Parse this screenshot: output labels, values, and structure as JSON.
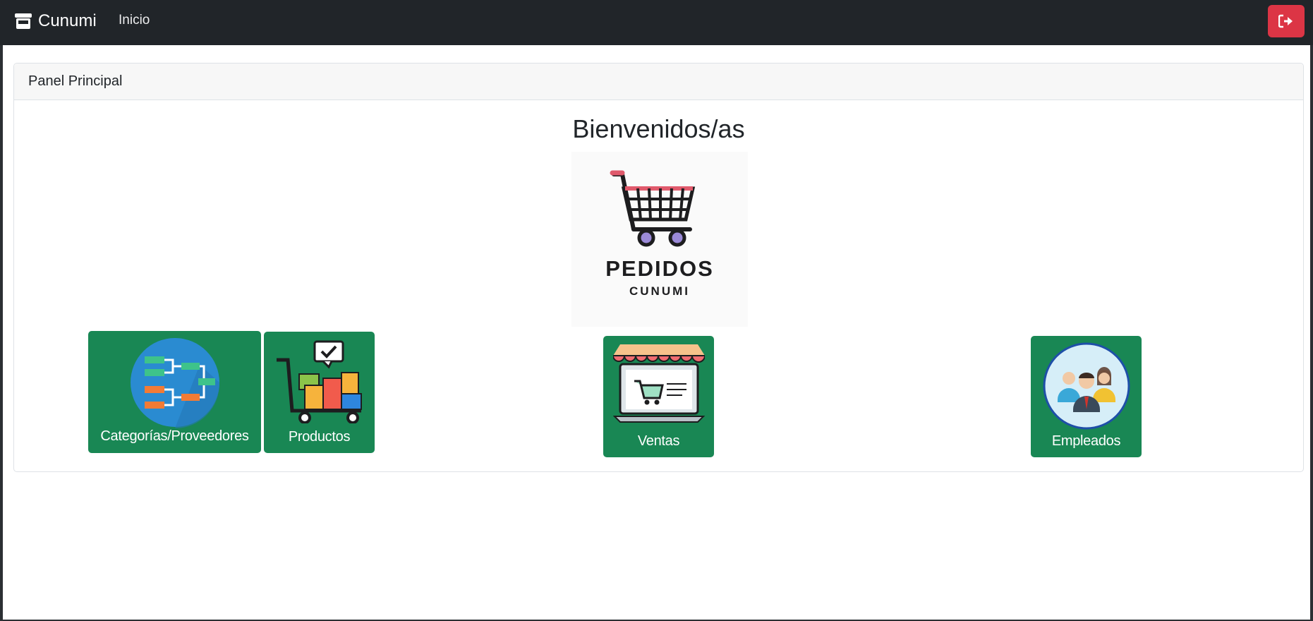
{
  "navbar": {
    "brand": "Cunumi",
    "brand_icon": "store-icon",
    "links": [
      {
        "label": "Inicio"
      }
    ],
    "logout_icon": "sign-out-icon",
    "colors": {
      "background": "#212529",
      "logout": "#dc3545"
    }
  },
  "panel": {
    "header": "Panel Principal",
    "welcome": "Bienvenidos/as",
    "logo": {
      "title": "PEDIDOS",
      "subtitle": "CUNUMI",
      "icon": "shopping-cart-icon"
    }
  },
  "tiles": [
    {
      "label": "Categorías/Proveedores",
      "icon": "hierarchy-icon"
    },
    {
      "label": "Productos",
      "icon": "product-cart-icon"
    },
    {
      "label": "Ventas",
      "icon": "online-store-icon"
    },
    {
      "label": "Empleados",
      "icon": "employees-icon"
    }
  ],
  "colors": {
    "tile": "#198754",
    "accent": "#dc3545"
  }
}
